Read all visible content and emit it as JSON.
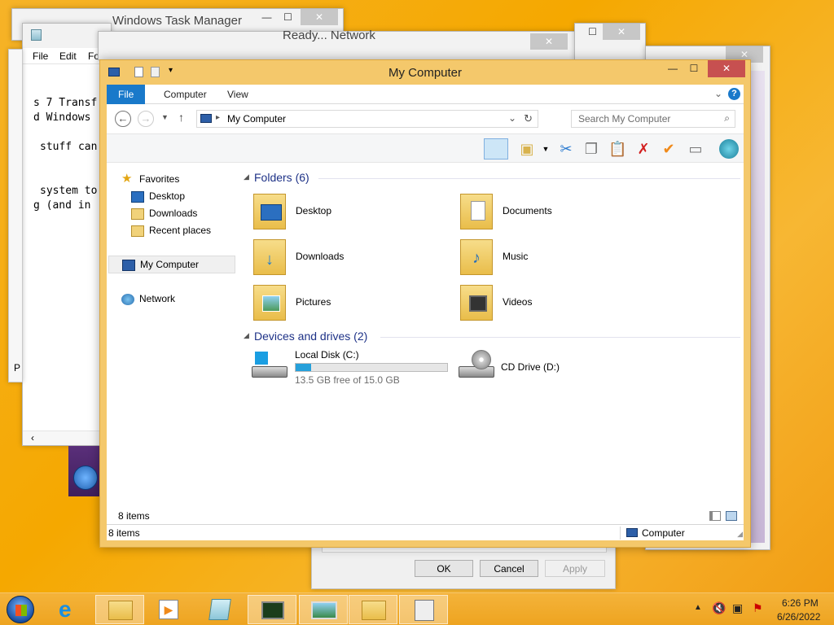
{
  "task_manager": {
    "title": "Windows Task Manager"
  },
  "notepad": {
    "menu": [
      "File",
      "Edit",
      "Fo"
    ],
    "lines": [
      "s 7 Transf",
      "d Windows",
      "stuff can",
      "system to",
      "g (and in"
    ],
    "left_char": "P"
  },
  "background_window": {
    "title": "Ready... Network"
  },
  "dialog": {
    "ok": "OK",
    "cancel": "Cancel",
    "apply": "Apply"
  },
  "explorer": {
    "title": "My Computer",
    "ribbon_tabs": [
      "File",
      "Computer",
      "View"
    ],
    "address": "My Computer",
    "search_placeholder": "Search My Computer",
    "nav": {
      "favorites": "Favorites",
      "desktop": "Desktop",
      "downloads": "Downloads",
      "recent": "Recent places",
      "my_computer": "My Computer",
      "network": "Network"
    },
    "folders_header": "Folders (6)",
    "folders": [
      "Desktop",
      "Documents",
      "Downloads",
      "Music",
      "Pictures",
      "Videos"
    ],
    "devices_header": "Devices and drives (2)",
    "local_disk": {
      "name": "Local Disk (C:)",
      "free": "13.5 GB free of 15.0 GB",
      "used_fraction": 0.1
    },
    "cd_drive": {
      "name": "CD Drive (D:)"
    },
    "items_count": "8 items",
    "status_left": "8 items",
    "status_right": "Computer",
    "accent": "#1979ca"
  },
  "taskbar": {
    "time": "6:26 PM",
    "date": "6/26/2022"
  }
}
